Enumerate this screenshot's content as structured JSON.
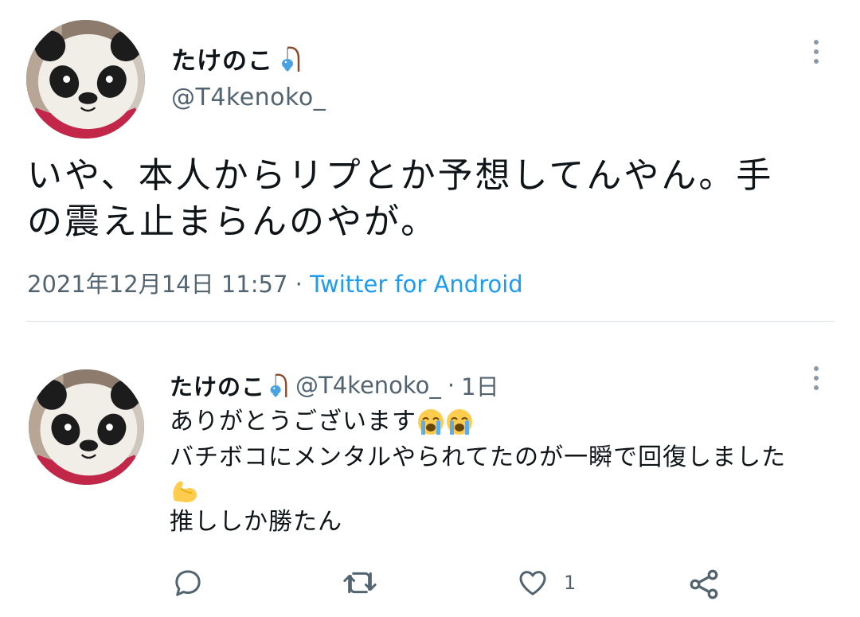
{
  "main_tweet": {
    "display_name": "たけのこ",
    "name_emoji": "fishing-icon",
    "handle": "@T4kenoko_",
    "text_line1": "いや、本人からリプとか予想してんやん。手",
    "text_line2": "の震え止まらんのやが。",
    "timestamp": "2021年12月14日 11:57",
    "separator": "·",
    "source": "Twitter for Android"
  },
  "reply_tweet": {
    "display_name": "たけのこ",
    "name_emoji": "fishing-icon",
    "handle": "@T4kenoko_",
    "separator": "·",
    "time": "1日",
    "line1": "ありがとうございます",
    "line1_emojis": [
      "loudly-crying-face-icon",
      "loudly-crying-face-icon"
    ],
    "line2": "バチボコにメンタルやられてたのが一瞬で回復しました",
    "line3_emoji": "flexed-biceps-icon",
    "line4": "推ししか勝たん",
    "actions": {
      "reply_icon": "reply-icon",
      "retweet_icon": "retweet-icon",
      "like_icon": "heart-icon",
      "like_count": "1",
      "share_icon": "share-icon"
    }
  },
  "colors": {
    "text": "#0f1419",
    "secondary": "#536471",
    "link": "#1d9bf0",
    "divider": "#dbe0e4"
  }
}
